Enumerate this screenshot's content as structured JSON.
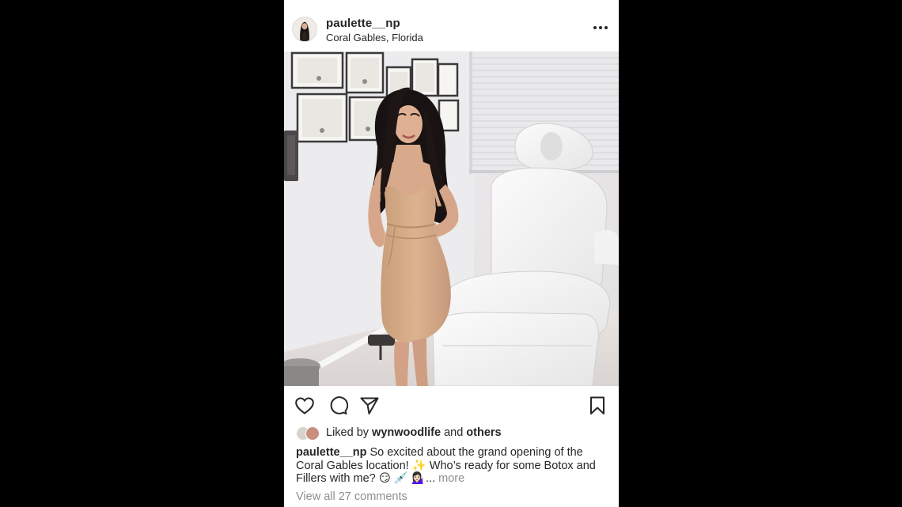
{
  "post": {
    "username": "paulette__np",
    "location": "Coral Gables, Florida"
  },
  "icons": {
    "more": "more-options-icon",
    "like": "heart-icon",
    "comment": "comment-bubble-icon",
    "share": "paper-plane-icon",
    "save": "bookmark-icon"
  },
  "likes": {
    "prefix": "Liked by ",
    "user": "wynwoodlife",
    "joiner": " and ",
    "others": "others"
  },
  "caption": {
    "username": "paulette__np",
    "text": " So excited about the grand opening of the Coral Gables location! ✨ Who’s ready for some Botox and Fillers with me? 😏 💉 💁🏻‍♀️",
    "ellipsis": "... ",
    "more": "more"
  },
  "comments": {
    "view_all": "View all 27 comments"
  },
  "colors": {
    "background": "#000000",
    "card": "#ffffff",
    "text": "#262626",
    "muted": "#8e8e8e",
    "dress": "#d5ab86",
    "hair": "#1a1412"
  }
}
